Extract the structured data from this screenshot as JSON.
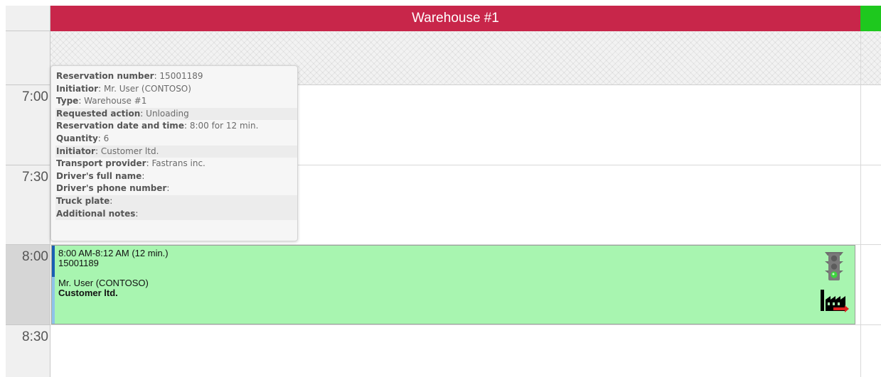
{
  "header": {
    "resource_name": "Warehouse #1",
    "header_color": "#c8264a",
    "status_color": "#1ec81e"
  },
  "time_slots": [
    "7:00",
    "7:30",
    "8:00",
    "8:30"
  ],
  "event": {
    "time_range": "8:00 AM-8:12 AM (12 min.)",
    "reservation_number": "15001189",
    "initiator": "Mr. User (CONTOSO)",
    "customer": "Customer ltd.",
    "background_color": "#a8f5b0",
    "icons": [
      "traffic-light-icon",
      "factory-unloading-icon"
    ]
  },
  "tooltip": {
    "rows": [
      {
        "label": "Reservation number",
        "value": "15001189"
      },
      {
        "label": "Initiatior",
        "value": "Mr. User (CONTOSO)"
      },
      {
        "label": "Type",
        "value": "Warehouse #1"
      },
      {
        "label": "Requested action",
        "value": "Unloading"
      },
      {
        "label": "Reservation date and time",
        "value": "8:00 for 12 min."
      },
      {
        "label": "Quantity",
        "value": "6"
      },
      {
        "label": "Initiator",
        "value": "Customer ltd."
      },
      {
        "label": "Transport provider",
        "value": "Fastrans inc."
      },
      {
        "label": "Driver's full name",
        "value": ""
      },
      {
        "label": "Driver's phone number",
        "value": ""
      },
      {
        "label": "Truck plate",
        "value": ""
      },
      {
        "label": "Additional notes",
        "value": ""
      }
    ]
  }
}
